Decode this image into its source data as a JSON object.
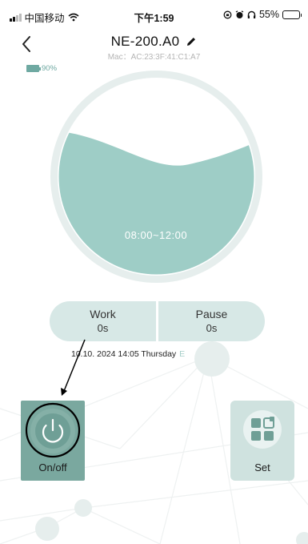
{
  "status_bar": {
    "carrier": "中国移动",
    "time": "下午1:59",
    "battery_percent": "55%",
    "battery_level": 0.55,
    "icons": [
      "signal-icon",
      "wifi-icon",
      "orientation-lock-icon",
      "alarm-icon",
      "headphones-icon",
      "phone-battery-icon"
    ]
  },
  "header": {
    "back_icon": "chevron-left-icon",
    "title": "NE-200.A0",
    "edit_icon": "pencil-icon",
    "mac": "Mac：AC:23:3F:41:C1:A7"
  },
  "device_battery": {
    "percent": "90%",
    "level": 0.9
  },
  "gauge": {
    "time_range": "08:00~12:00",
    "fill_level": 0.62,
    "colors": {
      "fill": "#9ecdc6",
      "ring": "#e6eeed"
    }
  },
  "stats": {
    "work_label": "Work",
    "work_value": "0s",
    "pause_label": "Pause",
    "pause_value": "0s"
  },
  "datetime": "10.10. 2024 14:05 Thursday",
  "datetime_tail": "E",
  "controls": {
    "onoff_label": "On/off",
    "onoff_icon": "power-icon",
    "set_label": "Set",
    "set_icon": "settings-grid-icon"
  },
  "colors": {
    "accent": "#7aa89f",
    "accent_light": "#cfe2df",
    "pill": "#d7e8e6"
  }
}
